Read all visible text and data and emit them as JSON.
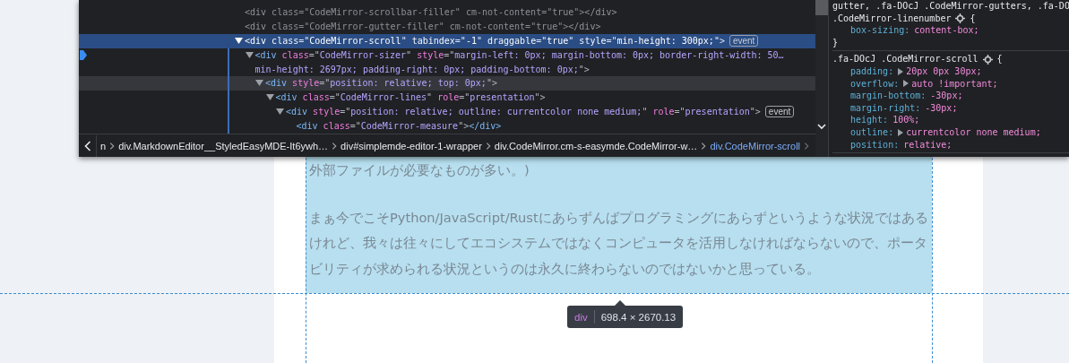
{
  "devtools": {
    "dom_tree": [
      {
        "segments": [
          {
            "kind": "tag",
            "text": "<div "
          },
          {
            "kind": "attr",
            "text": "class"
          },
          {
            "kind": "punct",
            "text": "=\""
          },
          {
            "kind": "value",
            "text": "CodeMirror-scrollbar-filler"
          },
          {
            "kind": "punct",
            "text": "\" "
          },
          {
            "kind": "attr",
            "text": "cm-not-content"
          },
          {
            "kind": "punct",
            "text": "=\""
          },
          {
            "kind": "value",
            "text": "true"
          },
          {
            "kind": "punct",
            "text": "\">"
          },
          {
            "kind": "tag",
            "text": "</div>"
          }
        ],
        "dimmed": true,
        "selected": false,
        "hovered": false
      },
      {
        "segments": [
          {
            "kind": "tag",
            "text": "<div "
          },
          {
            "kind": "attr",
            "text": "class"
          },
          {
            "kind": "punct",
            "text": "=\""
          },
          {
            "kind": "value",
            "text": "CodeMirror-gutter-filler"
          },
          {
            "kind": "punct",
            "text": "\" "
          },
          {
            "kind": "attr",
            "text": "cm-not-content"
          },
          {
            "kind": "punct",
            "text": "=\""
          },
          {
            "kind": "value",
            "text": "true"
          },
          {
            "kind": "punct",
            "text": "\">"
          },
          {
            "kind": "tag",
            "text": "</div>"
          }
        ],
        "dimmed": true,
        "selected": false,
        "hovered": false
      },
      {
        "segments": [
          {
            "kind": "tag",
            "text": "<div "
          },
          {
            "kind": "attr",
            "text": "class"
          },
          {
            "kind": "punct",
            "text": "=\""
          },
          {
            "kind": "value",
            "text": "CodeMirror-scroll"
          },
          {
            "kind": "punct",
            "text": "\" "
          },
          {
            "kind": "attr",
            "text": "tabindex"
          },
          {
            "kind": "punct",
            "text": "=\""
          },
          {
            "kind": "value",
            "text": "-1"
          },
          {
            "kind": "punct",
            "text": "\" "
          },
          {
            "kind": "attr",
            "text": "draggable"
          },
          {
            "kind": "punct",
            "text": "=\""
          },
          {
            "kind": "value",
            "text": "true"
          },
          {
            "kind": "punct",
            "text": "\" "
          },
          {
            "kind": "attr",
            "text": "style"
          },
          {
            "kind": "punct",
            "text": "=\""
          },
          {
            "kind": "value",
            "text": "min-height: 300px;"
          },
          {
            "kind": "punct",
            "text": "\">"
          }
        ],
        "badge": "event",
        "expanded": true,
        "dimmed": false,
        "selected": true,
        "hovered": false,
        "children": [
          {
            "segments": [
              {
                "kind": "tag",
                "text": "<div "
              },
              {
                "kind": "attr",
                "text": "class"
              },
              {
                "kind": "punct",
                "text": "=\""
              },
              {
                "kind": "value",
                "text": "CodeMirror-sizer"
              },
              {
                "kind": "punct",
                "text": "\" "
              },
              {
                "kind": "attr",
                "text": "style"
              },
              {
                "kind": "punct",
                "text": "=\""
              },
              {
                "kind": "value",
                "text": "margin-left: 0px; margin-bottom: 0px; border-right-width: 50…min-height: 2697px; padding-right: 0px; padding-bottom: 0px;"
              },
              {
                "kind": "punct",
                "text": "\">"
              }
            ],
            "expanded": true,
            "dimmed": false,
            "selected": false,
            "hovered": false,
            "children": [
              {
                "segments": [
                  {
                    "kind": "tag",
                    "text": "<div "
                  },
                  {
                    "kind": "attr",
                    "text": "style"
                  },
                  {
                    "kind": "punct",
                    "text": "=\""
                  },
                  {
                    "kind": "value",
                    "text": "position: relative; top: 0px;"
                  },
                  {
                    "kind": "punct",
                    "text": "\">"
                  }
                ],
                "expanded": true,
                "dimmed": false,
                "selected": false,
                "hovered": true,
                "children": [
                  {
                    "segments": [
                      {
                        "kind": "tag",
                        "text": "<div "
                      },
                      {
                        "kind": "attr",
                        "text": "class"
                      },
                      {
                        "kind": "punct",
                        "text": "=\""
                      },
                      {
                        "kind": "value",
                        "text": "CodeMirror-lines"
                      },
                      {
                        "kind": "punct",
                        "text": "\" "
                      },
                      {
                        "kind": "attr",
                        "text": "role"
                      },
                      {
                        "kind": "punct",
                        "text": "=\""
                      },
                      {
                        "kind": "value",
                        "text": "presentation"
                      },
                      {
                        "kind": "punct",
                        "text": "\">"
                      }
                    ],
                    "expanded": true,
                    "dimmed": false,
                    "selected": false,
                    "hovered": false,
                    "children": [
                      {
                        "segments": [
                          {
                            "kind": "tag",
                            "text": "<div "
                          },
                          {
                            "kind": "attr",
                            "text": "style"
                          },
                          {
                            "kind": "punct",
                            "text": "=\""
                          },
                          {
                            "kind": "value",
                            "text": "position: relative; outline: currentcolor none medium;"
                          },
                          {
                            "kind": "punct",
                            "text": "\" "
                          },
                          {
                            "kind": "attr",
                            "text": "role"
                          },
                          {
                            "kind": "punct",
                            "text": "=\""
                          },
                          {
                            "kind": "value",
                            "text": "presentation"
                          },
                          {
                            "kind": "punct",
                            "text": "\">"
                          }
                        ],
                        "badge": "event",
                        "expanded": true,
                        "dimmed": false,
                        "selected": false,
                        "hovered": false,
                        "children": [
                          {
                            "segments": [
                              {
                                "kind": "tag",
                                "text": "<div "
                              },
                              {
                                "kind": "attr",
                                "text": "class"
                              },
                              {
                                "kind": "punct",
                                "text": "=\""
                              },
                              {
                                "kind": "value",
                                "text": "CodeMirror-measure"
                              },
                              {
                                "kind": "punct",
                                "text": "\">"
                              },
                              {
                                "kind": "tag",
                                "text": "</div>"
                              }
                            ],
                            "dimmed": false,
                            "selected": false,
                            "hovered": false
                          }
                        ]
                      }
                    ]
                  }
                ]
              }
            ]
          }
        ]
      }
    ],
    "breadcrumbs": [
      {
        "label": "n",
        "selected": false
      },
      {
        "label": "div.MarkdownEditor__StyledEasyMDE-It6ywh…",
        "selected": false
      },
      {
        "label": "div#simplemde-editor-1-wrapper",
        "selected": false
      },
      {
        "label": "div.CodeMirror.cm-s-easymde.CodeMirror-w…",
        "selected": false
      },
      {
        "label": "div.CodeMirror-scroll",
        "selected": true
      }
    ],
    "styles": [
      {
        "selector_lines": [
          "gutter, .fa-DOcJ .CodeMirror-gutters, .fa-DO",
          ".CodeMirror-linenumber"
        ],
        "open": "{",
        "declarations": [
          {
            "property": "box-sizing:",
            "value": "content-box;",
            "expandable": false
          }
        ],
        "close": "}"
      },
      {
        "selector_lines": [
          ".fa-DOcJ .CodeMirror-scroll"
        ],
        "open": "{",
        "declarations": [
          {
            "property": "padding:",
            "value": "20px 0px 30px;",
            "expandable": true
          },
          {
            "property": "overflow:",
            "value": "auto !important;",
            "expandable": true
          },
          {
            "property": "margin-bottom:",
            "value": "-30px;",
            "expandable": false
          },
          {
            "property": "margin-right:",
            "value": "-30px;",
            "expandable": false
          },
          {
            "property": "height:",
            "value": "100%;",
            "expandable": false
          },
          {
            "property": "outline:",
            "value": "currentcolor none medium;",
            "expandable": true
          },
          {
            "property": "position:",
            "value": "relative;",
            "expandable": false
          }
        ]
      }
    ]
  },
  "page": {
    "paragraphs": [
      "外部ファイルが必要なものが多い。)",
      "まぁ今でこそPython/JavaScript/Rustにあらずんばプログラミングにあらずというような状況ではあるけれど、我々は往々にしてエコシステムではなくコンピュータを活用しなければならないので、ポータビリティが求められる状況というのは永久に終わらないのではないかと思っている。"
    ],
    "tooltip": {
      "tag": "div",
      "size": "698.4 × 2670.13"
    }
  }
}
